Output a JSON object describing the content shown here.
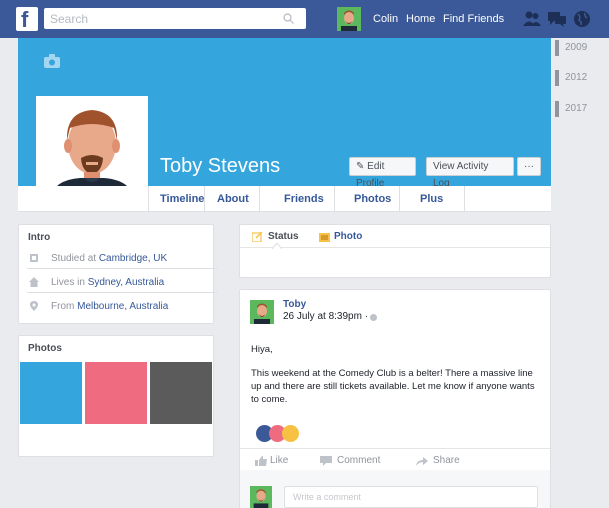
{
  "colors": {
    "brand_blue": "#3b5998",
    "cover_blue": "#35a6dd",
    "link_blue": "#365899",
    "avatar_green": "#5cb85c"
  },
  "topnav": {
    "logo_letter": "f",
    "search_placeholder": "Search",
    "user_name": "Colin",
    "home_label": "Home",
    "find_friends_label": "Find Friends",
    "icons": [
      "friends-icon",
      "messages-icon",
      "globe-icon"
    ]
  },
  "profile": {
    "name": "Toby Stevens",
    "edit_profile_label": "Edit Profile",
    "activity_log_label": "View Activity Log",
    "more_label": "···"
  },
  "tabs": [
    "Timeline",
    "About",
    "Friends",
    "Photos",
    "Plus"
  ],
  "years": [
    "2009",
    "2012",
    "2017"
  ],
  "intro": {
    "title": "Intro",
    "rows": [
      {
        "prefix": "Studied at ",
        "value": "Cambridge, UK",
        "icon": "education-icon"
      },
      {
        "prefix": "Lives in ",
        "value": "Sydney, Australia",
        "icon": "home-icon"
      },
      {
        "prefix": "From ",
        "value": "Melbourne, Australia",
        "icon": "location-pin-icon"
      }
    ]
  },
  "photos": {
    "title": "Photos",
    "tiles": [
      "#35a6dd",
      "#ef6b80",
      "#5b5b5b"
    ]
  },
  "composer": {
    "status_label": "Status",
    "photo_label": "Photo"
  },
  "post": {
    "author": "Toby",
    "date": "26 July at 8:39pm ·",
    "greeting": "Hiya,",
    "body": "This weekend at the Comedy Club is a belter! There a massive line up and there are still tickets available. Let me know if anyone wants to come.",
    "reaction_colors": [
      "#3b5998",
      "#ef6b80",
      "#f7c244"
    ],
    "like_label": "Like",
    "comment_label": "Comment",
    "share_label": "Share",
    "comment_placeholder": "Write a comment"
  }
}
